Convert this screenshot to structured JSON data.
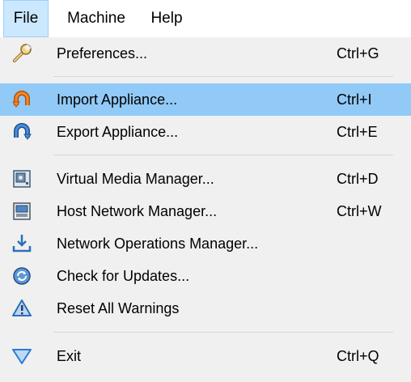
{
  "menubar": {
    "items": [
      {
        "label": "File"
      },
      {
        "label": "Machine"
      },
      {
        "label": "Help"
      }
    ]
  },
  "menu": {
    "items": [
      {
        "label": "Preferences...",
        "shortcut": "Ctrl+G",
        "icon": "wrench-icon"
      },
      {
        "label": "Import Appliance...",
        "shortcut": "Ctrl+I",
        "icon": "import-appliance-icon"
      },
      {
        "label": "Export Appliance...",
        "shortcut": "Ctrl+E",
        "icon": "export-appliance-icon"
      },
      {
        "label": "Virtual Media Manager...",
        "shortcut": "Ctrl+D",
        "icon": "virtual-media-icon"
      },
      {
        "label": "Host Network Manager...",
        "shortcut": "Ctrl+W",
        "icon": "host-network-icon"
      },
      {
        "label": "Network Operations Manager...",
        "shortcut": "",
        "icon": "download-tray-icon"
      },
      {
        "label": "Check for Updates...",
        "shortcut": "",
        "icon": "refresh-icon"
      },
      {
        "label": "Reset All Warnings",
        "shortcut": "",
        "icon": "warning-icon"
      },
      {
        "label": "Exit",
        "shortcut": "Ctrl+Q",
        "icon": "exit-triangle-icon"
      }
    ]
  },
  "colors": {
    "highlight": "#91c9f7",
    "menubar_active": "#cce8ff",
    "icon_orange": "#e8731e",
    "icon_blue": "#2d6fb7"
  }
}
